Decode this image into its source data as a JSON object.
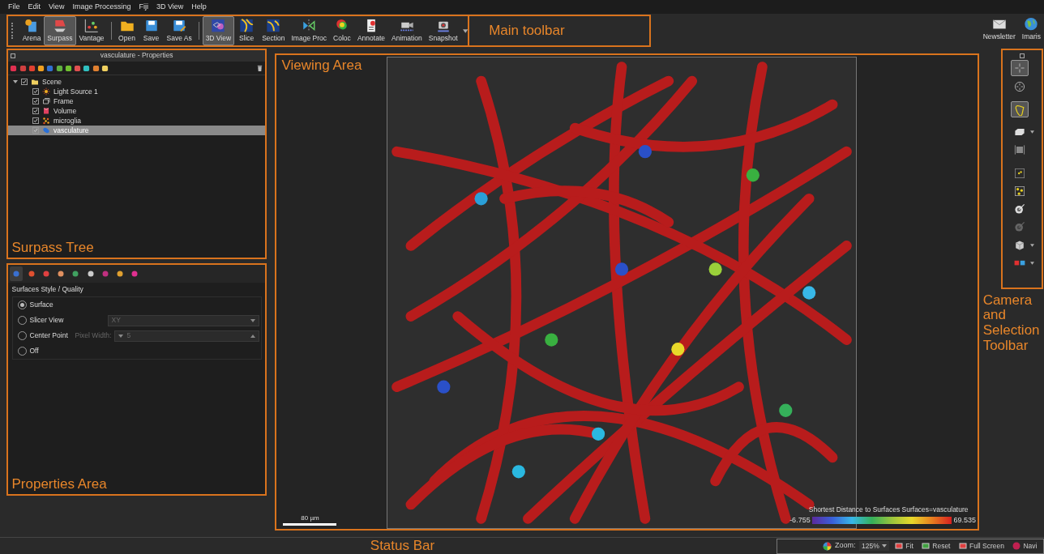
{
  "menu": [
    "File",
    "Edit",
    "View",
    "Image Processing",
    "Fiji",
    "3D View",
    "Help"
  ],
  "toolbar": {
    "annotation": "Main toolbar",
    "groups": [
      [
        {
          "label": "Arena",
          "kind": "arena",
          "selected": false
        },
        {
          "label": "Surpass",
          "kind": "surpass",
          "selected": true
        },
        {
          "label": "Vantage",
          "kind": "vantage",
          "selected": false
        }
      ],
      [
        {
          "label": "Open",
          "kind": "open",
          "selected": false
        },
        {
          "label": "Save",
          "kind": "save",
          "selected": false
        },
        {
          "label": "Save As",
          "kind": "saveas",
          "selected": false
        }
      ],
      [
        {
          "label": "3D View",
          "kind": "view3d",
          "selected": true
        },
        {
          "label": "Slice",
          "kind": "slice",
          "selected": false
        },
        {
          "label": "Section",
          "kind": "section",
          "selected": false
        },
        {
          "label": "Image Proc",
          "kind": "imageproc",
          "selected": false
        },
        {
          "label": "Coloc",
          "kind": "coloc",
          "selected": false
        },
        {
          "label": "Annotate",
          "kind": "annotate",
          "selected": false
        },
        {
          "label": "Animation",
          "kind": "animation",
          "selected": false
        },
        {
          "label": "Snapshot",
          "kind": "snapshot",
          "selected": false
        }
      ]
    ],
    "right": [
      {
        "label": "Newsletter",
        "kind": "mail"
      },
      {
        "label": "Imaris",
        "kind": "globe"
      }
    ]
  },
  "surpass": {
    "title": "vasculature - Properties",
    "annotation": "Surpass Tree",
    "tree": [
      {
        "label": "Scene",
        "kind": "folder",
        "checked": true,
        "expanded": true,
        "selected": false,
        "children": [
          {
            "label": "Light Source 1",
            "kind": "light",
            "checked": true,
            "selected": false
          },
          {
            "label": "Frame",
            "kind": "frame",
            "checked": true,
            "selected": false
          },
          {
            "label": "Volume",
            "kind": "volume",
            "checked": true,
            "selected": false
          },
          {
            "label": "microglia",
            "kind": "spots",
            "checked": true,
            "selected": false
          },
          {
            "label": "vasculature",
            "kind": "surfaces",
            "checked": true,
            "selected": true
          }
        ]
      }
    ]
  },
  "properties": {
    "annotation": "Properties Area",
    "tabs": [
      {
        "selected": true
      },
      {
        "selected": false
      },
      {
        "selected": false
      },
      {
        "selected": false
      },
      {
        "selected": false
      },
      {
        "selected": false
      },
      {
        "selected": false
      },
      {
        "selected": false
      },
      {
        "selected": false
      }
    ],
    "heading": "Surfaces Style / Quality",
    "options": [
      {
        "label": "Surface",
        "kind": "plain",
        "selected": true
      },
      {
        "label": "Slicer View",
        "kind": "select",
        "selected": false,
        "value": "XY"
      },
      {
        "label": "Center Point",
        "kind": "spin",
        "selected": false,
        "field_label": "Pixel Width:",
        "value": "5"
      },
      {
        "label": "Off",
        "kind": "plain",
        "selected": false
      }
    ]
  },
  "viewer": {
    "annotation": "Viewing Area",
    "scale_bar": "80 µm",
    "legend": {
      "title": "Shortest Distance to Surfaces Surfaces=vasculature",
      "min": "-6.755",
      "max": "69.535"
    }
  },
  "camera_toolbar": {
    "annotation": "Camera and Selection Toolbar",
    "items": [
      {
        "kind": "pointer",
        "selected": true,
        "menu": false
      },
      {
        "kind": "navigate",
        "selected": false,
        "menu": false
      },
      {
        "kind": "lasso",
        "selected": true,
        "menu": false
      },
      {
        "kind": "box",
        "selected": false,
        "menu": true
      },
      {
        "kind": "fit",
        "selected": false,
        "menu": false
      },
      {
        "kind": "spots",
        "selected": false,
        "menu": false
      },
      {
        "kind": "spotsbig",
        "selected": false,
        "menu": false
      },
      {
        "kind": "target",
        "selected": false,
        "menu": false
      },
      {
        "kind": "targetdim",
        "selected": false,
        "menu": false
      },
      {
        "kind": "cube",
        "selected": false,
        "menu": true
      },
      {
        "kind": "stereo",
        "selected": false,
        "menu": true
      }
    ]
  },
  "status_bar": {
    "annotation": "Status Bar",
    "zoom_label": "Zoom:",
    "zoom_value": "125%",
    "buttons": [
      {
        "label": "Fit",
        "kind": "fit"
      },
      {
        "label": "Reset",
        "kind": "reset"
      },
      {
        "label": "Full Screen",
        "kind": "fullscreen"
      },
      {
        "label": "Navi",
        "kind": "navi"
      }
    ]
  }
}
